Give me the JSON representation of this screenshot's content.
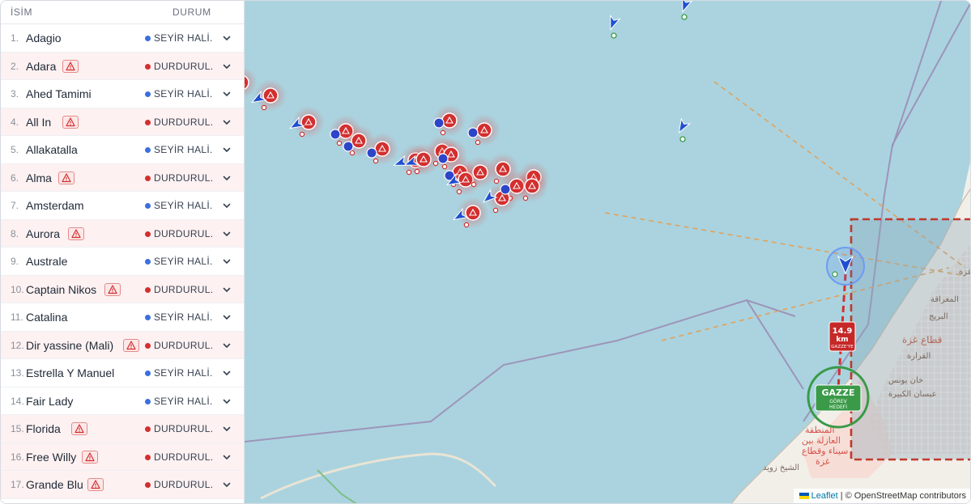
{
  "list": {
    "header_name": "İSİM",
    "header_status": "DURUM",
    "rows": [
      {
        "num": "1.",
        "name": "Adagio",
        "status": "SEYİR HALİ...",
        "state": "sailing",
        "warning": false
      },
      {
        "num": "2.",
        "name": "Adara",
        "status": "DURDURUL...",
        "state": "stopped",
        "warning": true
      },
      {
        "num": "3.",
        "name": "Ahed Tamimi",
        "status": "SEYİR HALİ...",
        "state": "sailing",
        "warning": false
      },
      {
        "num": "4.",
        "name": "All In",
        "status": "DURDURUL...",
        "state": "stopped",
        "warning": true
      },
      {
        "num": "5.",
        "name": "Allakatalla",
        "status": "SEYİR HALİ...",
        "state": "sailing",
        "warning": false
      },
      {
        "num": "6.",
        "name": "Alma",
        "status": "DURDURUL...",
        "state": "stopped",
        "warning": true
      },
      {
        "num": "7.",
        "name": "Amsterdam",
        "status": "SEYİR HALİ...",
        "state": "sailing",
        "warning": false
      },
      {
        "num": "8.",
        "name": "Aurora",
        "status": "DURDURUL...",
        "state": "stopped",
        "warning": true
      },
      {
        "num": "9.",
        "name": "Australe",
        "status": "SEYİR HALİ...",
        "state": "sailing",
        "warning": false
      },
      {
        "num": "10.",
        "name": "Captain Nikos",
        "status": "DURDURUL...",
        "state": "stopped",
        "warning": true
      },
      {
        "num": "11.",
        "name": "Catalina",
        "status": "SEYİR HALİ...",
        "state": "sailing",
        "warning": false
      },
      {
        "num": "12.",
        "name": "Dir yassine (Mali)",
        "status": "DURDURUL...",
        "state": "stopped",
        "warning": true
      },
      {
        "num": "13.",
        "name": "Estrella Y Manuel",
        "status": "SEYİR HALİ...",
        "state": "sailing",
        "warning": false
      },
      {
        "num": "14.",
        "name": "Fair Lady",
        "status": "SEYİR HALİ...",
        "state": "sailing",
        "warning": false
      },
      {
        "num": "15.",
        "name": "Florida",
        "status": "DURDURUL...",
        "state": "stopped",
        "warning": true
      },
      {
        "num": "16.",
        "name": "Free Willy",
        "status": "DURDURUL...",
        "state": "stopped",
        "warning": true
      },
      {
        "num": "17.",
        "name": "Grande Blu",
        "status": "DURDURUL...",
        "state": "stopped",
        "warning": true
      }
    ]
  },
  "colors": {
    "sailing": "#3b6fe0",
    "stopped": "#d32f2f",
    "sea": "#aad3df",
    "land": "#f2efe9",
    "target": "#3a9a47"
  },
  "map": {
    "distance_value": "14.9",
    "distance_unit": "km",
    "distance_caption": "GAZZE'YE",
    "target_title": "GAZZE",
    "target_sub1": "GÖREV",
    "target_sub2": "HEDEFİ",
    "labels": {
      "al_maghraqa": "المغراقة",
      "al_burayj": "البريج",
      "gaza_strip": "قطاع غزة",
      "al_qarara": "القرارة",
      "khan_yunis": "خان يونس",
      "absan": "عبسان الكبيرة",
      "buffer_1": "المنطقة",
      "buffer_2": "العازلة بين",
      "buffer_3": "سيناء وقطاع",
      "buffer_4": "غزة",
      "sheikh_zuwayed": "الشيخ زويد",
      "gaza_city_fragment": "غزة"
    },
    "attribution_leaflet": "Leaflet",
    "attribution_rest": "| © OpenStreetMap contributors"
  }
}
